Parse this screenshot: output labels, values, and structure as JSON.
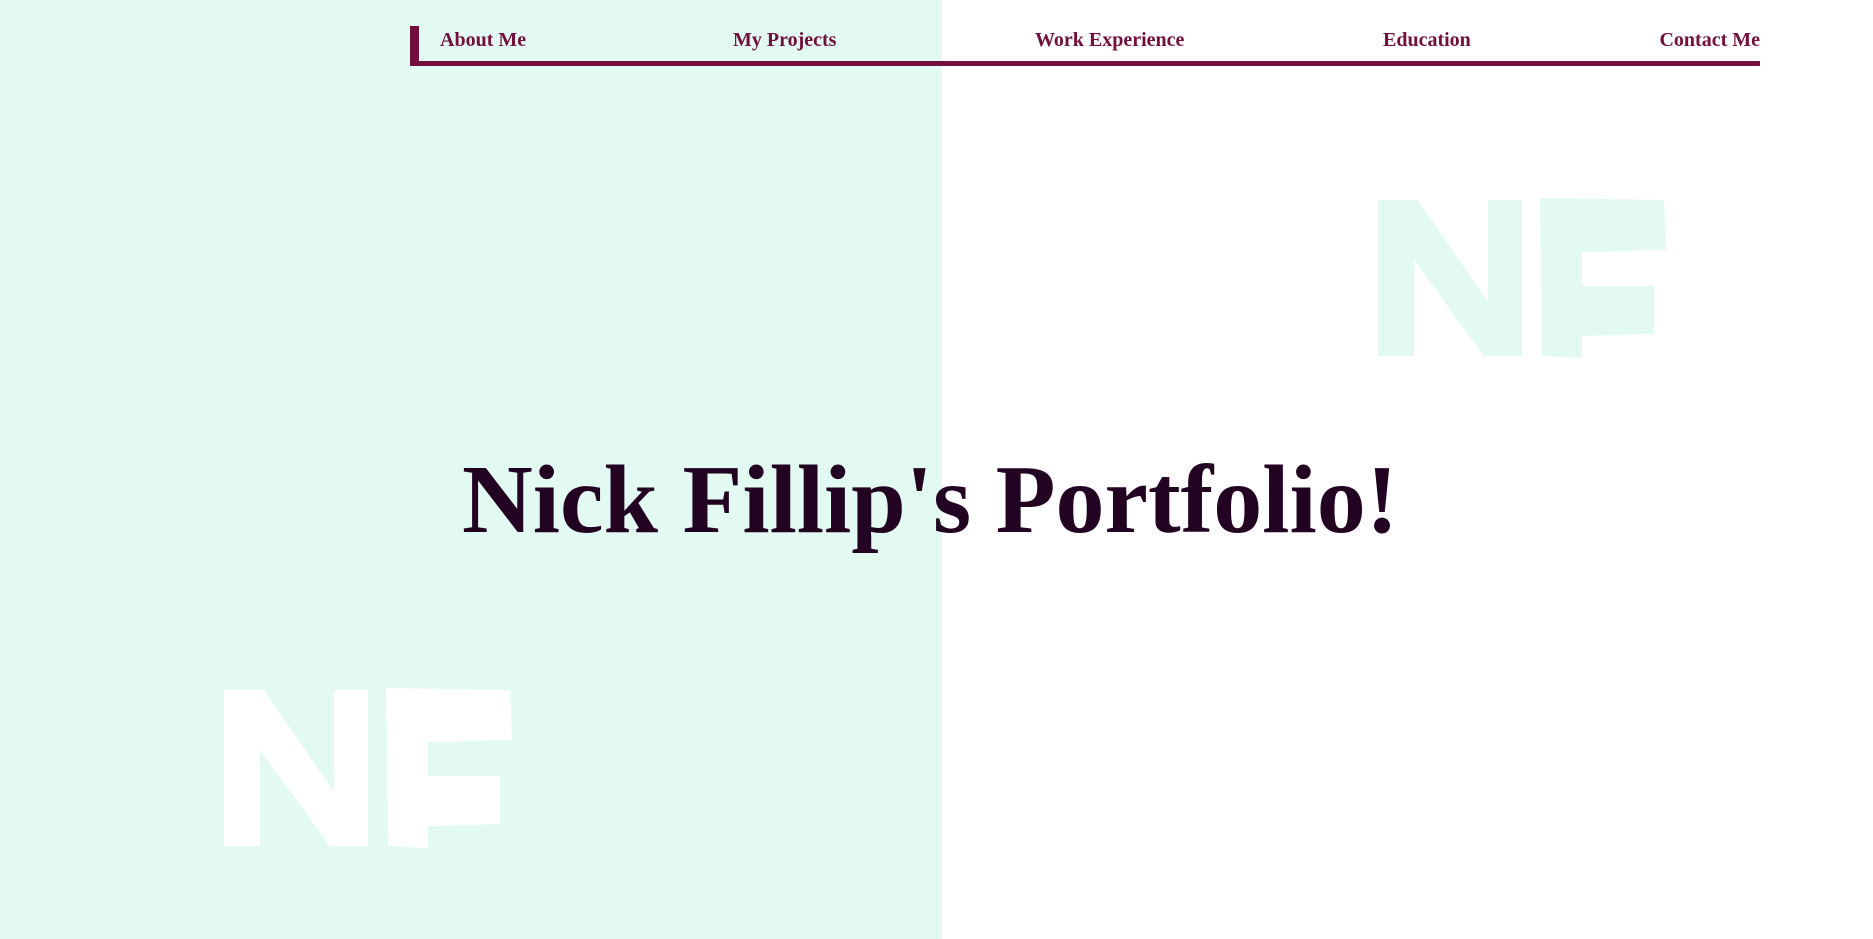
{
  "nav": {
    "items": [
      {
        "label": "About Me"
      },
      {
        "label": "My Projects"
      },
      {
        "label": "Work Experience"
      },
      {
        "label": "Education"
      },
      {
        "label": "Contact Me"
      }
    ]
  },
  "hero": {
    "title": "Nick Fillip's Portfolio!"
  },
  "decor": {
    "monogram": "NF",
    "colors": {
      "accent": "#730f3c",
      "title": "#220322",
      "mint": "#e3faf3",
      "white": "#ffffff"
    }
  }
}
